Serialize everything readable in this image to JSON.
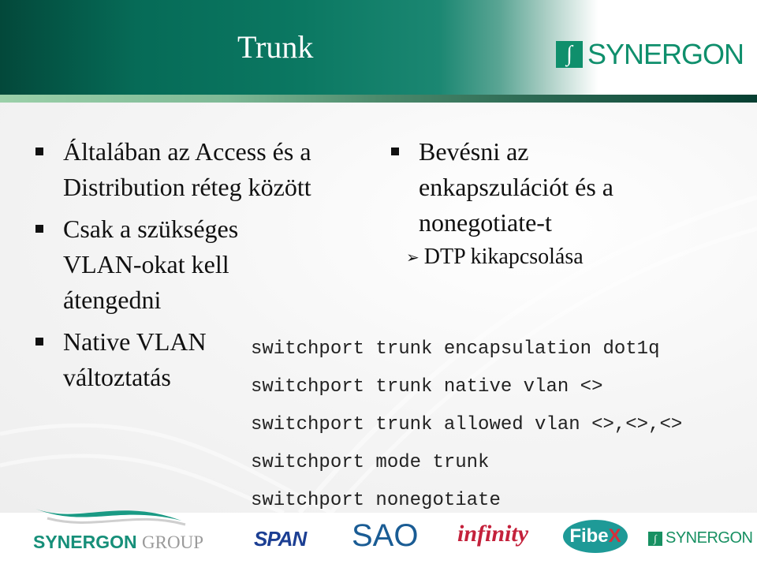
{
  "header": {
    "title": "Trunk",
    "logo_text": "SYNERGON",
    "logo_mark": "∫"
  },
  "left_bullets": [
    {
      "lines": [
        "Általában az Access és a",
        "Distribution réteg között"
      ]
    },
    {
      "lines": [
        "Csak a szükséges",
        "VLAN-okat kell",
        "átengedni"
      ]
    },
    {
      "lines": [
        "Native VLAN",
        "változtatás"
      ]
    }
  ],
  "right_bullet": {
    "lines": [
      "Bevésni az",
      "enkapszulációt és a",
      "nonegotiate-t"
    ],
    "sub_arrow": "➢",
    "sub_item": "DTP kikapcsolása"
  },
  "code_lines": [
    "switchport trunk encapsulation dot1q",
    "switchport trunk native vlan <>",
    "switchport trunk allowed vlan <>,<>,<>",
    "switchport mode trunk",
    "switchport nonegotiate"
  ],
  "footer": {
    "group_name": "SYNERGON",
    "group_suffix": "GROUP",
    "logos": {
      "span": "SPAN",
      "sao": "SAO",
      "infinity": "infinity",
      "fibex_a": "Fibe",
      "fibex_b": "X",
      "synergon": "SYNERGON",
      "synergon_mark": "∫"
    }
  },
  "colors": {
    "brand_green": "#0f8f6c",
    "header_dark": "#03483a"
  }
}
